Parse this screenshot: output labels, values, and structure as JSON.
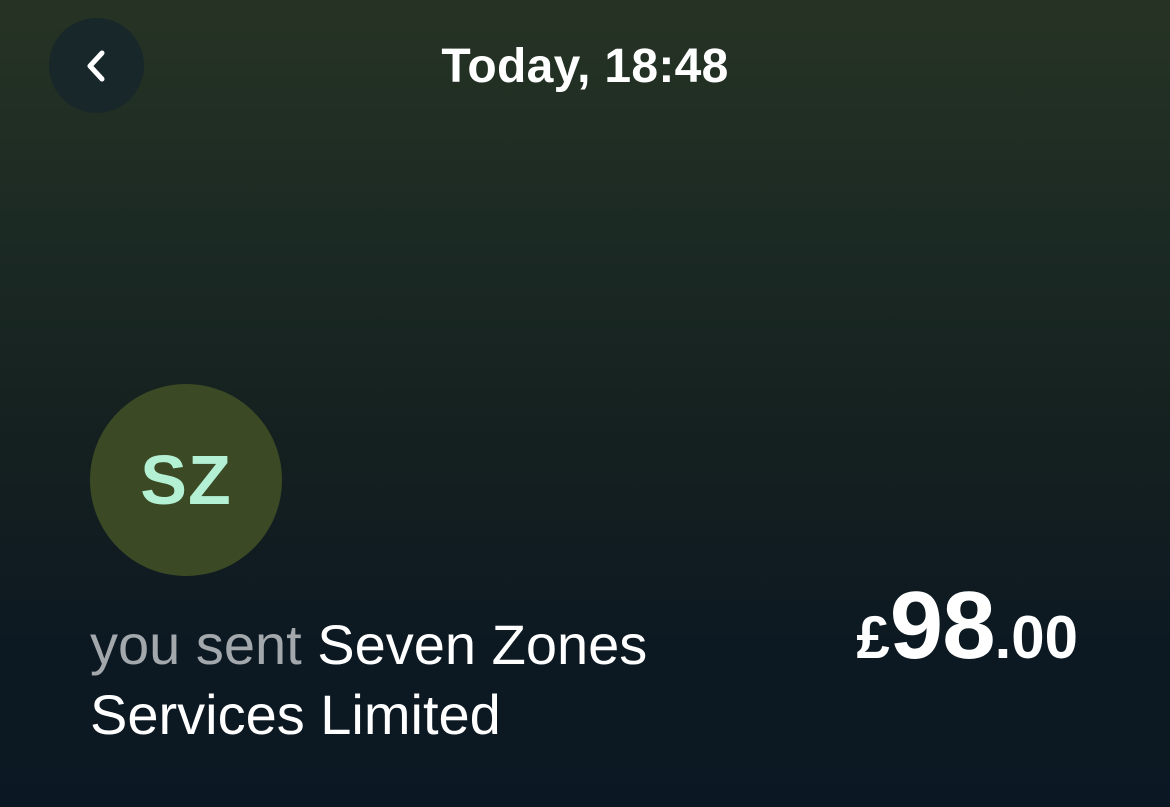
{
  "header": {
    "title": "Today, 18:48",
    "back_icon": "chevron-left-icon"
  },
  "transaction": {
    "avatar_initials": "SZ",
    "direction_label": "you sent",
    "counterparty": "Seven Zones Services Limited",
    "amount": {
      "currency_symbol": "£",
      "major": "98",
      "minor": ".00"
    }
  },
  "colors": {
    "background_top": "#263324",
    "background_bottom": "#0b1722",
    "avatar_background": "#3b4a24",
    "avatar_text": "#b4f0d4",
    "muted_text": "#a3a8ac"
  }
}
